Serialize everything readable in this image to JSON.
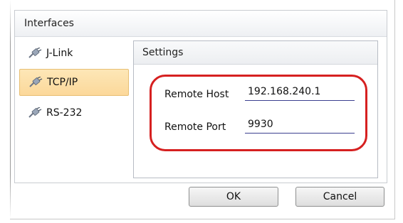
{
  "interfaces_group": {
    "title": "Interfaces",
    "items": [
      {
        "label": "J-Link",
        "icon": "plug-icon",
        "selected": false
      },
      {
        "label": "TCP/IP",
        "icon": "plug-icon",
        "selected": true
      },
      {
        "label": "RS-232",
        "icon": "plug-icon",
        "selected": false
      }
    ]
  },
  "settings": {
    "title": "Settings",
    "remote_host_label": "Remote Host",
    "remote_host_value": "192.168.240.1",
    "remote_port_label": "Remote Port",
    "remote_port_value": "9930"
  },
  "buttons": {
    "ok": "OK",
    "cancel": "Cancel"
  },
  "colors": {
    "selection": "#fcd89a",
    "highlight": "#d62020",
    "field_underline": "#3b3f8f"
  }
}
